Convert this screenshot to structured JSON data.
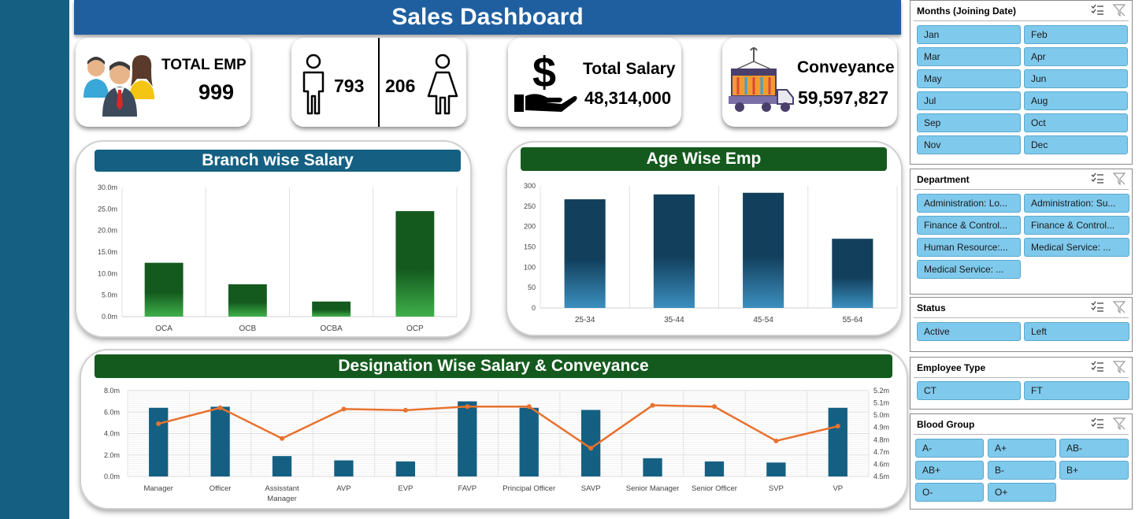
{
  "title": "Sales Dashboard",
  "kpis": {
    "total_emp_label": "TOTAL EMP",
    "total_emp_value": "999",
    "male_count": "793",
    "female_count": "206",
    "total_salary_label": "Total Salary",
    "total_salary_value": "48,314,000",
    "conveyance_label": "Conveyance",
    "conveyance_value": "59,597,827"
  },
  "colors": {
    "sidebar": "#156082",
    "title_bar": "#1f5fa0",
    "branch_title": "#156082",
    "green_title": "#145a1e",
    "bar_green": "#1e7a28",
    "bar_blue": "#156082",
    "line_orange": "#e8722e",
    "slicer_button": "#7fc9ec"
  },
  "chart_data": [
    {
      "type": "bar",
      "title": "Branch wise Salary",
      "categories": [
        "OCA",
        "OCB",
        "OCBA",
        "OCP"
      ],
      "values": [
        12.5,
        7.5,
        3.5,
        24.5
      ],
      "ylim": [
        0,
        30
      ],
      "yticks": [
        "0.0m",
        "5.0m",
        "10.0m",
        "15.0m",
        "20.0m",
        "25.0m",
        "30.0m"
      ],
      "grid": "vertical"
    },
    {
      "type": "bar",
      "title": "Age Wise Emp",
      "categories": [
        "25-34",
        "35-44",
        "45-54",
        "55-64"
      ],
      "values": [
        267,
        279,
        283,
        170
      ],
      "ylim": [
        0,
        300
      ],
      "yticks": [
        "0",
        "50",
        "100",
        "150",
        "200",
        "250",
        "300"
      ],
      "grid": "vertical"
    },
    {
      "type": "bar",
      "title": "Designation Wise Salary & Conveyance",
      "categories": [
        "Manager",
        "Officer",
        "Assisstant Manager",
        "AVP",
        "EVP",
        "FAVP",
        "Principal Officer",
        "SAVP",
        "Senior Manager",
        "Senior Officer",
        "SVP",
        "VP"
      ],
      "series": [
        {
          "values": [
            6.4,
            6.5,
            1.9,
            1.5,
            1.4,
            7.0,
            6.4,
            6.2,
            1.7,
            1.4,
            1.3,
            6.4
          ]
        },
        {
          "values": [
            4.93,
            5.06,
            4.81,
            5.05,
            5.04,
            5.07,
            5.07,
            4.73,
            5.08,
            5.07,
            4.79,
            4.91
          ]
        }
      ],
      "ylim": [
        0,
        8
      ],
      "yticks": [
        "0.0m",
        "2.0m",
        "4.0m",
        "6.0m",
        "8.0m"
      ],
      "y2lim": [
        4.5,
        5.2
      ],
      "y2ticks": [
        "4.5m",
        "4.6m",
        "4.7m",
        "4.8m",
        "4.9m",
        "5.0m",
        "5.1m",
        "5.2m"
      ],
      "grid": "both"
    }
  ],
  "slicers": {
    "months": {
      "title": "Months (Joining Date)",
      "items": [
        "Jan",
        "Feb",
        "Mar",
        "Apr",
        "May",
        "Jun",
        "Jul",
        "Aug",
        "Sep",
        "Oct",
        "Nov",
        "Dec"
      ]
    },
    "department": {
      "title": "Department",
      "items": [
        "Administration: Lo...",
        "Administration: Su...",
        "Finance & Control...",
        "Finance & Control...",
        "Human Resource:...",
        "Medical Service: ...",
        "Medical Service: ..."
      ]
    },
    "status": {
      "title": "Status",
      "items": [
        "Active",
        "Left"
      ]
    },
    "employee_type": {
      "title": "Employee Type",
      "items": [
        "CT",
        "FT"
      ]
    },
    "blood_group": {
      "title": "Blood Group",
      "items": [
        "A-",
        "A+",
        "AB-",
        "AB+",
        "B-",
        "B+",
        "O-",
        "O+"
      ]
    }
  }
}
